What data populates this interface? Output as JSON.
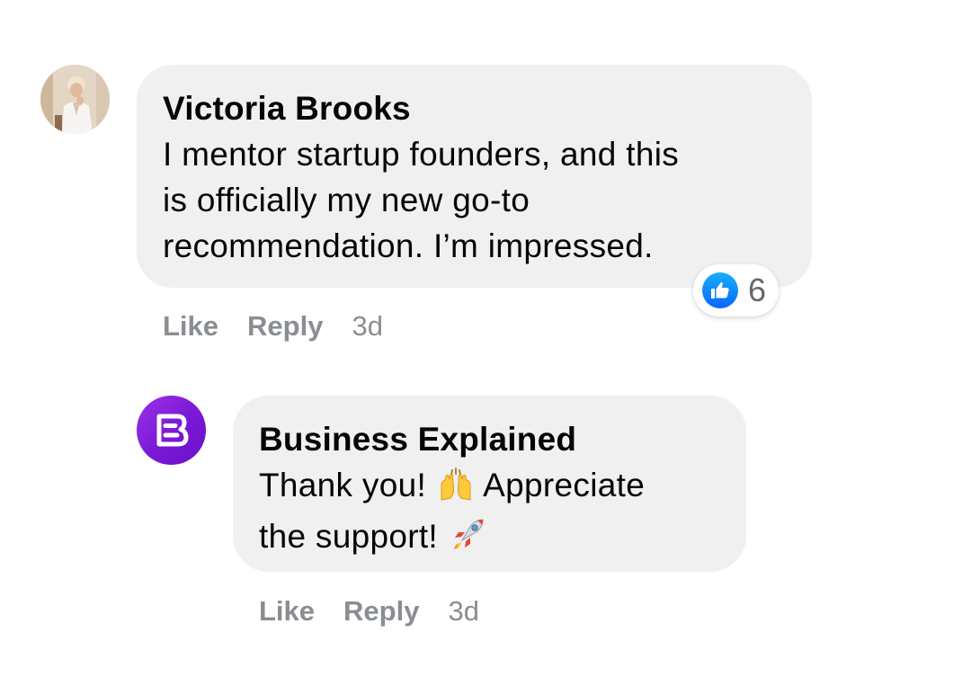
{
  "comments": [
    {
      "author": "Victoria Brooks",
      "lines": [
        "I mentor startup founders, and this",
        "is officially my new go-to",
        "recommendation. I’m impressed."
      ],
      "reaction": {
        "icon": "like-icon",
        "count": "6"
      },
      "actions": {
        "like": "Like",
        "reply": "Reply",
        "time": "3d"
      }
    },
    {
      "author": "Business Explained",
      "lines": [
        {
          "before": "Thank you! ",
          "emoji": "raising-hands-emoji",
          "after": " Appreciate"
        },
        {
          "before": "the support! ",
          "emoji": "rocket-emoji"
        }
      ],
      "actions": {
        "like": "Like",
        "reply": "Reply",
        "time": "3d"
      }
    }
  ],
  "colors": {
    "bubble": "#f0f0f0",
    "like_blue": "#0866ff",
    "brand_purple": "#7a18d6",
    "meta_gray": "#8a8d91"
  }
}
